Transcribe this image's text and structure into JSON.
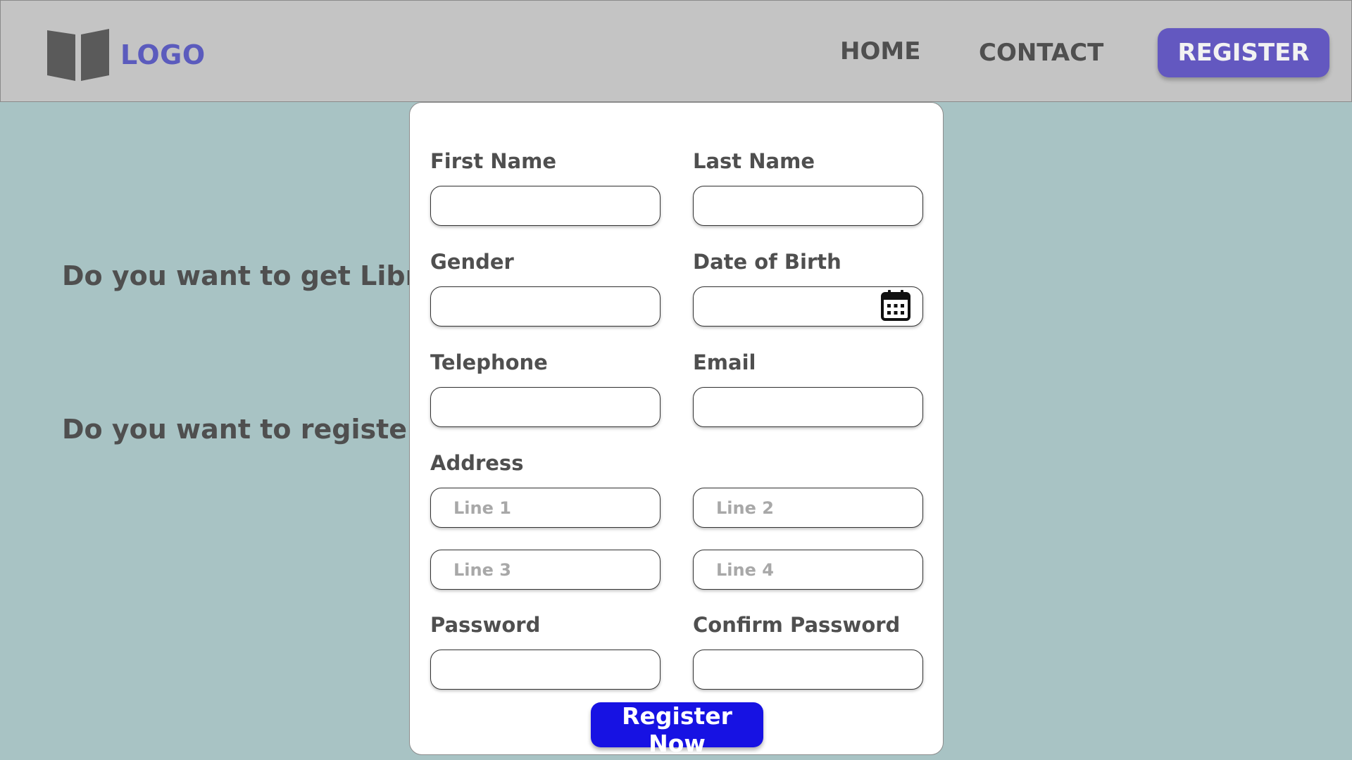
{
  "header": {
    "logo_text": "LOGO",
    "nav": {
      "home": "HOME",
      "contact": "CONTACT"
    },
    "register_label": "REGISTER"
  },
  "background": {
    "question_1": "Do you want to get Library",
    "question_2": "Do you want to register as"
  },
  "form": {
    "first_name_label": "First Name",
    "last_name_label": "Last Name",
    "gender_label": "Gender",
    "dob_label": "Date of Birth",
    "telephone_label": "Telephone",
    "email_label": "Email",
    "address_label": "Address",
    "address_line1_placeholder": "Line 1",
    "address_line2_placeholder": "Line 2",
    "address_line3_placeholder": "Line 3",
    "address_line4_placeholder": "Line 4",
    "password_label": "Password",
    "confirm_password_label": "Confirm Password",
    "submit_label": "Register Now"
  },
  "icons": {
    "logo": "open-book-icon",
    "date_picker": "calendar-icon"
  },
  "colors": {
    "header_bg": "#c4c4c4",
    "page_bg": "#a8c3c4",
    "accent": "#6358c0",
    "submit": "#1712e3",
    "text": "#4f4f4f"
  }
}
